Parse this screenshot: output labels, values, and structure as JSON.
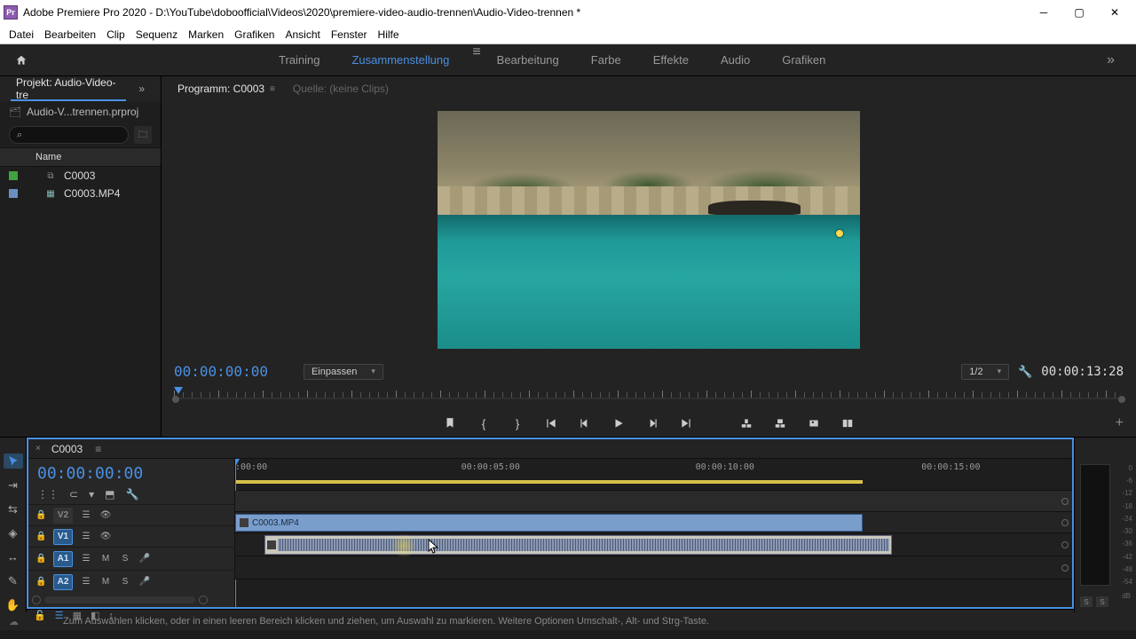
{
  "window": {
    "title": "Adobe Premiere Pro 2020 - D:\\YouTube\\doboofficial\\Videos\\2020\\premiere-video-audio-trennen\\Audio-Video-trennen *"
  },
  "menus": [
    "Datei",
    "Bearbeiten",
    "Clip",
    "Sequenz",
    "Marken",
    "Grafiken",
    "Ansicht",
    "Fenster",
    "Hilfe"
  ],
  "workspaces": {
    "tabs": [
      "Training",
      "Zusammenstellung",
      "Bearbeitung",
      "Farbe",
      "Effekte",
      "Audio",
      "Grafiken"
    ],
    "active": "Zusammenstellung"
  },
  "project": {
    "tab_label": "Projekt: Audio-Video-tre",
    "filename": "Audio-V...trennen.prproj",
    "search_placeholder": "",
    "column_name": "Name",
    "items": [
      {
        "name": "C0003",
        "type": "sequence",
        "swatch": "green"
      },
      {
        "name": "C0003.MP4",
        "type": "clip",
        "swatch": "blue"
      }
    ]
  },
  "program": {
    "tab_active": "Programm: C0003",
    "tab_source": "Quelle: (keine Clips)",
    "left_timecode": "00:00:00:00",
    "fit_label": "Einpassen",
    "res_label": "1/2",
    "right_timecode": "00:00:13:28"
  },
  "timeline": {
    "tab": "C0003",
    "timecode": "00:00:00:00",
    "ruler_marks": [
      ":00:00",
      "00:00:05:00",
      "00:00:10:00",
      "00:00:15:00"
    ],
    "tracks": {
      "v2": {
        "label": "V2"
      },
      "v1": {
        "label": "V1",
        "active": true
      },
      "a1": {
        "label": "A1",
        "active": true,
        "m": "M",
        "s": "S"
      },
      "a2": {
        "label": "A2",
        "active": true,
        "m": "M",
        "s": "S"
      }
    },
    "clip_name": "C0003.MP4"
  },
  "meters": {
    "scale": [
      "0",
      "-6",
      "-12",
      "-18",
      "-24",
      "-30",
      "-36",
      "-42",
      "-48",
      "-54"
    ],
    "db": "dB",
    "solo": "S"
  },
  "status": "Zum Auswählen klicken, oder in einen leeren Bereich klicken und ziehen, um Auswahl zu markieren. Weitere Optionen Umschalt-, Alt- und Strg-Taste."
}
